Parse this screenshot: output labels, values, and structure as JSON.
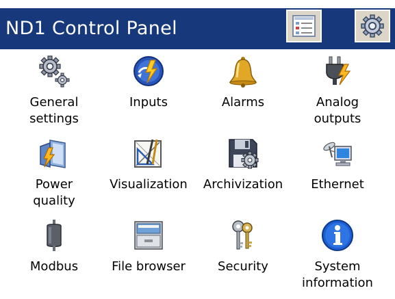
{
  "window": {
    "title": "ND1 Control Panel",
    "colors": {
      "titlebar": "#17387a",
      "title_text": "#ffffff",
      "button_face": "#dcd6c8"
    }
  },
  "toolbar": {
    "buttons": [
      {
        "icon": "list-view-icon"
      },
      {
        "icon": "gear-icon"
      }
    ]
  },
  "tiles": [
    {
      "label": "General\nsettings",
      "icon": "gears-icon"
    },
    {
      "label": "Inputs",
      "icon": "inputs-globe-icon"
    },
    {
      "label": "Alarms",
      "icon": "bell-icon"
    },
    {
      "label": "Analog\noutputs",
      "icon": "plug-icon"
    },
    {
      "label": "Power\nquality",
      "icon": "power-quality-icon"
    },
    {
      "label": "Visualization",
      "icon": "drafting-icon"
    },
    {
      "label": "Archivization",
      "icon": "floppy-disk-icon"
    },
    {
      "label": "Ethernet",
      "icon": "network-computer-icon"
    },
    {
      "label": "Modbus",
      "icon": "modbus-connector-icon"
    },
    {
      "label": "File browser",
      "icon": "file-cabinet-icon"
    },
    {
      "label": "Security",
      "icon": "keys-icon"
    },
    {
      "label": "System\ninformation",
      "icon": "info-icon"
    }
  ]
}
